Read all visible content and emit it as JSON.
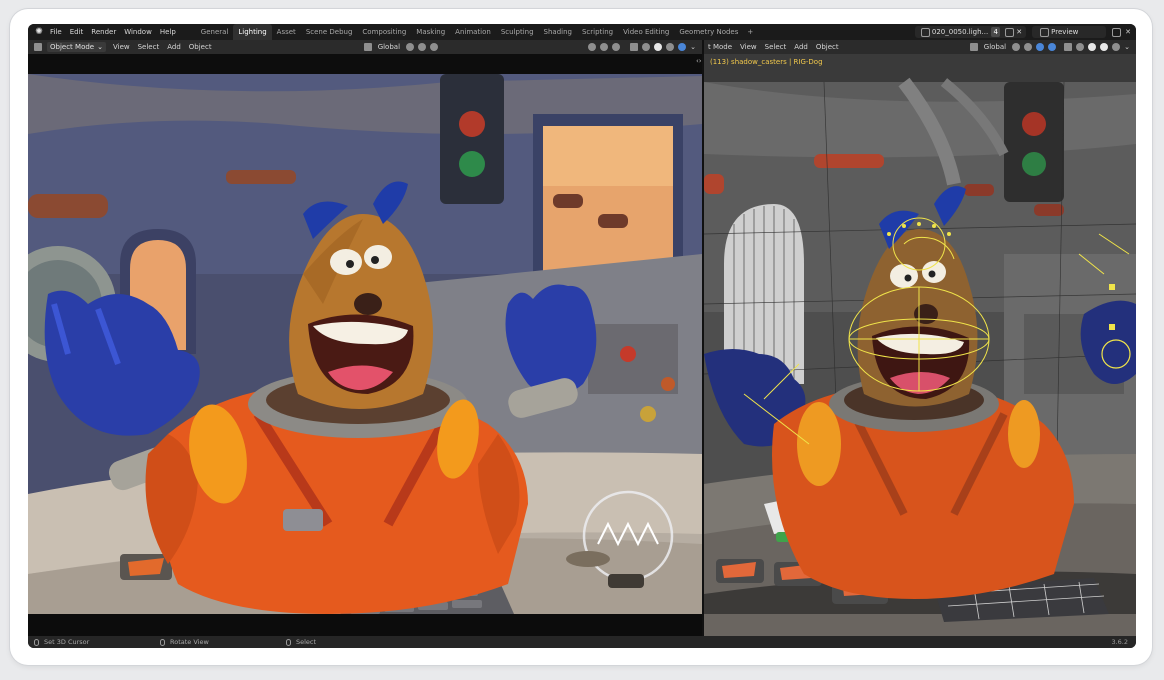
{
  "menu": [
    "File",
    "Edit",
    "Render",
    "Window",
    "Help"
  ],
  "workspace_tabs": [
    {
      "label": "General",
      "active": false
    },
    {
      "label": "Lighting",
      "active": true
    },
    {
      "label": "Asset",
      "active": false
    },
    {
      "label": "Scene Debug",
      "active": false
    },
    {
      "label": "Compositing",
      "active": false
    },
    {
      "label": "Masking",
      "active": false
    },
    {
      "label": "Animation",
      "active": false
    },
    {
      "label": "Sculpting",
      "active": false
    },
    {
      "label": "Shading",
      "active": false
    },
    {
      "label": "Scripting",
      "active": false
    },
    {
      "label": "Video Editing",
      "active": false
    },
    {
      "label": "Geometry Nodes",
      "active": false
    }
  ],
  "workspace_add": "+",
  "scene": {
    "name": "020_0050.ligh...",
    "count": "4"
  },
  "view_layer": "Preview",
  "left_header": {
    "mode": "Object Mode",
    "items": [
      "View",
      "Select",
      "Add",
      "Object"
    ],
    "transform": "Global"
  },
  "right_header": {
    "mode": "t Mode",
    "items": [
      "View",
      "Select",
      "Add",
      "Object"
    ],
    "transform": "Global"
  },
  "right_viewport_label": "(113) shadow_casters | RIG-Dog",
  "status_bar": {
    "items": [
      "Set 3D Cursor",
      "Rotate View",
      "Select"
    ],
    "version": "3.6.2"
  },
  "colors": {
    "accent": "#4a86d8",
    "label_yellow": "#f2c94c",
    "suit_orange": "#e55a1e",
    "glove_blue": "#2a3ea8"
  },
  "icons": [
    "blender-logo",
    "mouse-icon",
    "viewport-shading-icons",
    "gizmo-icon",
    "overlay-icon"
  ]
}
